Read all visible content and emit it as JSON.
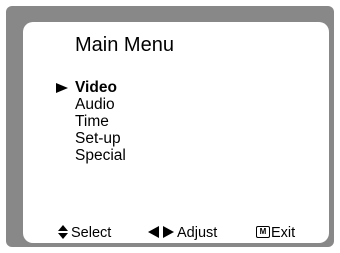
{
  "menu": {
    "title": "Main Menu",
    "items": [
      {
        "label": "Video",
        "selected": true
      },
      {
        "label": "Audio",
        "selected": false
      },
      {
        "label": "Time",
        "selected": false
      },
      {
        "label": "Set-up",
        "selected": false
      },
      {
        "label": "Special",
        "selected": false
      }
    ]
  },
  "footer": {
    "select_label": "Select",
    "adjust_label": "Adjust",
    "exit_key": "M",
    "exit_label": "Exit"
  },
  "icons": {
    "cursor": "play-triangle-icon",
    "select": "up-down-arrows-icon",
    "adjust": "left-right-arrows-icon",
    "exit": "menu-key-icon"
  },
  "colors": {
    "frame": "#888888",
    "screen": "#ffffff",
    "text": "#000000"
  }
}
